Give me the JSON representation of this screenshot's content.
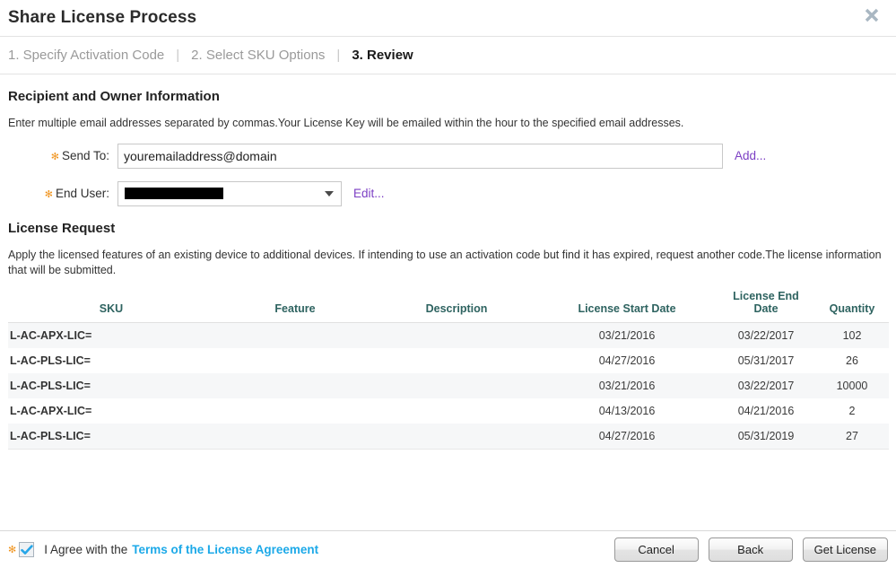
{
  "window": {
    "title": "Share License Process",
    "close_icon": "close-icon"
  },
  "stepper": {
    "separator": "|",
    "steps": [
      {
        "label": "1. Specify Activation Code",
        "active": false
      },
      {
        "label": "2. Select SKU Options",
        "active": false
      },
      {
        "label": "3. Review",
        "active": true
      }
    ]
  },
  "recipient": {
    "heading": "Recipient and Owner Information",
    "description": "Enter multiple email addresses separated by commas.Your License Key will be emailed within the hour to the specified email addresses.",
    "send_to": {
      "label": "Send To:",
      "required_marker": "✻",
      "value": "youremailaddress@domain",
      "placeholder": "",
      "action_link": "Add..."
    },
    "end_user": {
      "label": "End User:",
      "required_marker": "✻",
      "value": "",
      "action_link": "Edit...",
      "dropdown_icon": "chevron-down-icon"
    }
  },
  "license_request": {
    "heading": "License Request",
    "description": "Apply the licensed features of an existing device to additional devices. If intending to use an activation code but find it has expired, request another code.The license information that will be submitted.",
    "table": {
      "columns": [
        "SKU",
        "Feature",
        "Description",
        "License Start Date",
        "License End Date",
        "Quantity"
      ],
      "rows": [
        {
          "sku": "L-AC-APX-LIC=",
          "feature": "",
          "description": "",
          "start_date": "03/21/2016",
          "end_date": "03/22/2017",
          "quantity": "102"
        },
        {
          "sku": "L-AC-PLS-LIC=",
          "feature": "",
          "description": "",
          "start_date": "04/27/2016",
          "end_date": "05/31/2017",
          "quantity": "26"
        },
        {
          "sku": "L-AC-PLS-LIC=",
          "feature": "",
          "description": "",
          "start_date": "03/21/2016",
          "end_date": "03/22/2017",
          "quantity": "10000"
        },
        {
          "sku": "L-AC-APX-LIC=",
          "feature": "",
          "description": "",
          "start_date": "04/13/2016",
          "end_date": "04/21/2016",
          "quantity": "2"
        },
        {
          "sku": "L-AC-PLS-LIC=",
          "feature": "",
          "description": "",
          "start_date": "04/27/2016",
          "end_date": "05/31/2019",
          "quantity": "27"
        }
      ]
    }
  },
  "footer": {
    "required_marker": "✻",
    "agree_checked": true,
    "agree_text": "I Agree with the",
    "terms_link": "Terms of the License Agreement",
    "buttons": {
      "cancel": "Cancel",
      "back": "Back",
      "get_license": "Get License"
    }
  },
  "colors": {
    "accent_link": "#7c3fc4",
    "terms_link": "#1ca9e8",
    "table_header": "#2e6360",
    "required": "#f0941e",
    "close_icon": "#a9b7c2"
  }
}
